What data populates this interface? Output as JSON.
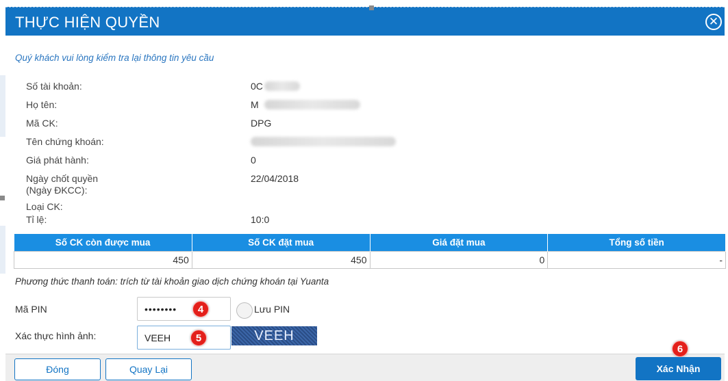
{
  "dialog": {
    "title": "THỰC HIỆN QUYỀN",
    "close_symbol": "✕",
    "intro": "Quý khách vui lòng kiểm tra lại thông tin yêu cầu"
  },
  "fields": [
    {
      "label": "Số tài khoản:",
      "value": "0C"
    },
    {
      "label": "Họ tên:",
      "value": "M"
    },
    {
      "label": "Mã CK:",
      "value": "DPG"
    },
    {
      "label": "Tên chứng khoán:",
      "value": ""
    },
    {
      "label": "Giá phát hành:",
      "value": "0"
    },
    {
      "label": "Ngày chốt quyền (Ngày ĐKCC):",
      "value": "22/04/2018"
    },
    {
      "label": "Loại CK:",
      "value": ""
    },
    {
      "label": "Tỉ lệ:",
      "value": "10:0"
    }
  ],
  "table": {
    "headers": [
      "Số CK còn được mua",
      "Số CK đặt mua",
      "Giá đặt mua",
      "Tổng số tiền"
    ],
    "row": [
      "450",
      "450",
      "0",
      "-"
    ]
  },
  "payment_note": "Phương thức thanh toán: trích từ tài khoản giao dịch chứng khoán tại Yuanta",
  "pin": {
    "label": "Mã PIN",
    "value": "••••••••",
    "save_label": "Lưu PIN"
  },
  "captcha": {
    "label": "Xác thực hình ảnh:",
    "value": "VEEH",
    "image_text": "VEEH"
  },
  "buttons": {
    "close": "Đóng",
    "back": "Quay Lại",
    "confirm": "Xác Nhận"
  },
  "steps": [
    "4",
    "5",
    "6"
  ],
  "colors": {
    "title_bar": "#1274c4",
    "table_header": "#1a8ee2",
    "step_badge": "#e3201b"
  }
}
